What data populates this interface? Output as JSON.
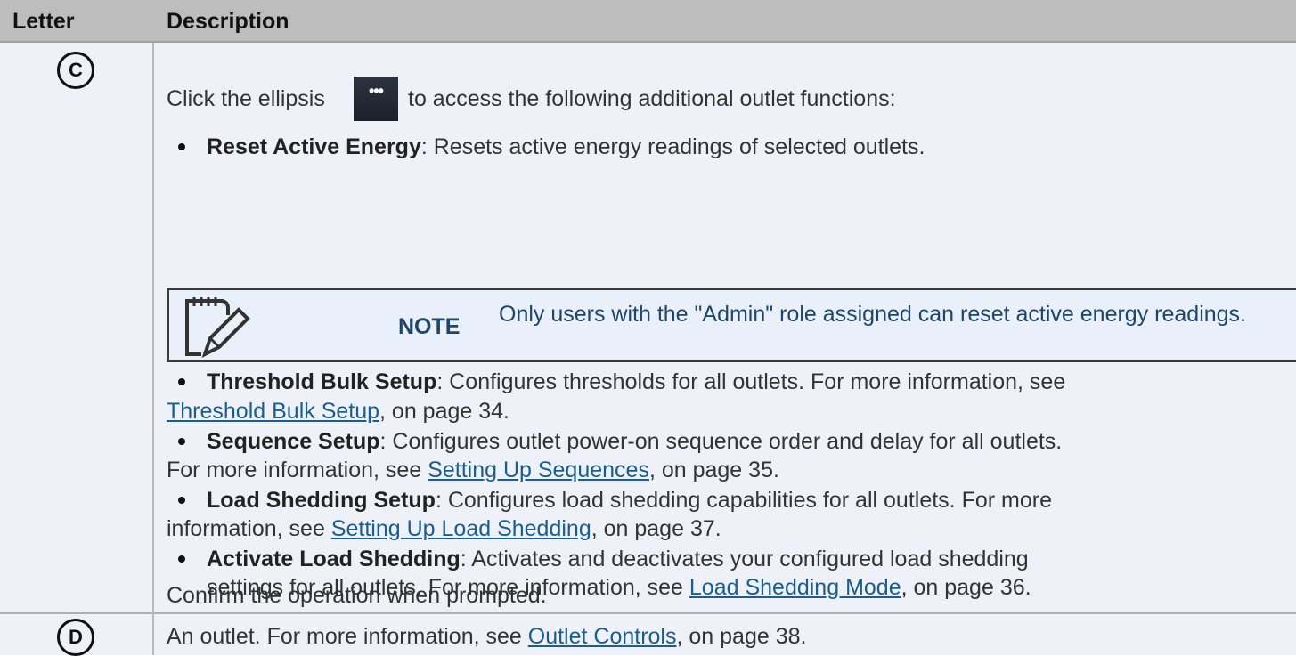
{
  "header": {
    "letter": "Letter",
    "description": "Description"
  },
  "rows": [
    {
      "badge": "C",
      "intro_before": "Click the ellipsis",
      "ellipsis_icon": "ellipsis-button-icon",
      "intro_after": "to access the following additional outlet functions:",
      "bullets": [
        {
          "bold": "Reset Active Energy",
          "text": ": Resets active energy readings of selected outlets."
        },
        {
          "bold": "Threshold Bulk Setup",
          "text": ": Configures thresholds for all outlets. For more information, see",
          "link": "Threshold Bulk Setup",
          "after": ", on page 34."
        },
        {
          "bold": "Sequence Setup",
          "text": ": Configures outlet power-on sequence order and delay for all outlets.",
          "prefix2": "For more information, see ",
          "link": "Setting Up Sequences",
          "after": ", on page 35."
        },
        {
          "bold": "Load Shedding Setup",
          "text": ": Configures load shedding capabilities for all outlets. For more",
          "prefix2": "information, see ",
          "link": "Setting Up Load Shedding",
          "after": ", on page 37."
        },
        {
          "bold": "Activate Load Shedding",
          "text": ": Activates and deactivates your configured load shedding",
          "prefix2": "settings for all outlets. For more information, see ",
          "link": "Load Shedding Mode",
          "after": ", on page 36."
        }
      ],
      "note": {
        "label": "NOTE",
        "text": "Only users with the \"Admin\" role assigned can reset active energy readings."
      },
      "footer": "Confirm the operation when prompted."
    },
    {
      "badge": "D",
      "text_before": "An outlet. For more information, see ",
      "link": "Outlet Controls",
      "after": ", on page 38."
    }
  ]
}
